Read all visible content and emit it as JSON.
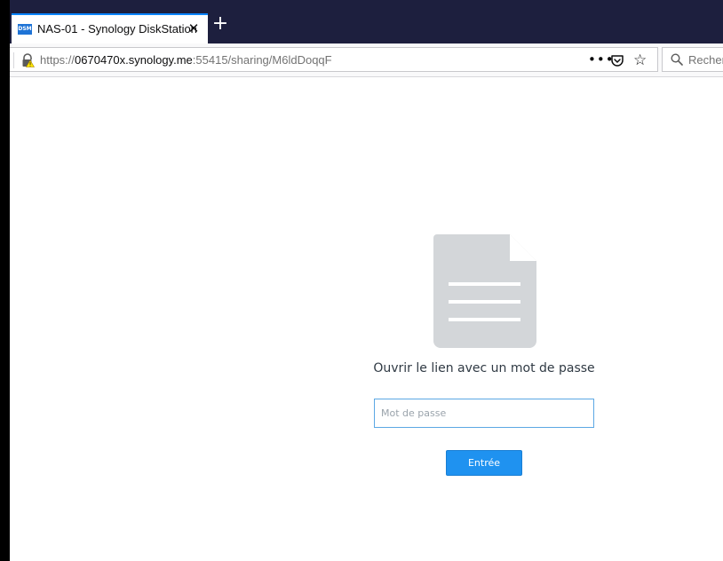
{
  "browser": {
    "tab": {
      "favicon_text": "DSM",
      "title": "NAS-01 - Synology DiskStation",
      "close_glyph": "✕"
    },
    "new_tab_glyph": "+",
    "address": {
      "scheme": "https://",
      "host": "0670470x.synology.me",
      "rest": ":55415/sharing/M6ldDoqqF"
    },
    "page_actions_glyph": "•••",
    "star_glyph": "☆",
    "search_placeholder": "Recher"
  },
  "page": {
    "title": "Ouvrir le lien avec un mot de passe",
    "password_placeholder": "Mot de passe",
    "submit_label": "Entrée"
  },
  "colors": {
    "tabstrip": "#1d1f3e",
    "accent": "#1f92f0",
    "doc_icon": "#d3d6d9"
  }
}
